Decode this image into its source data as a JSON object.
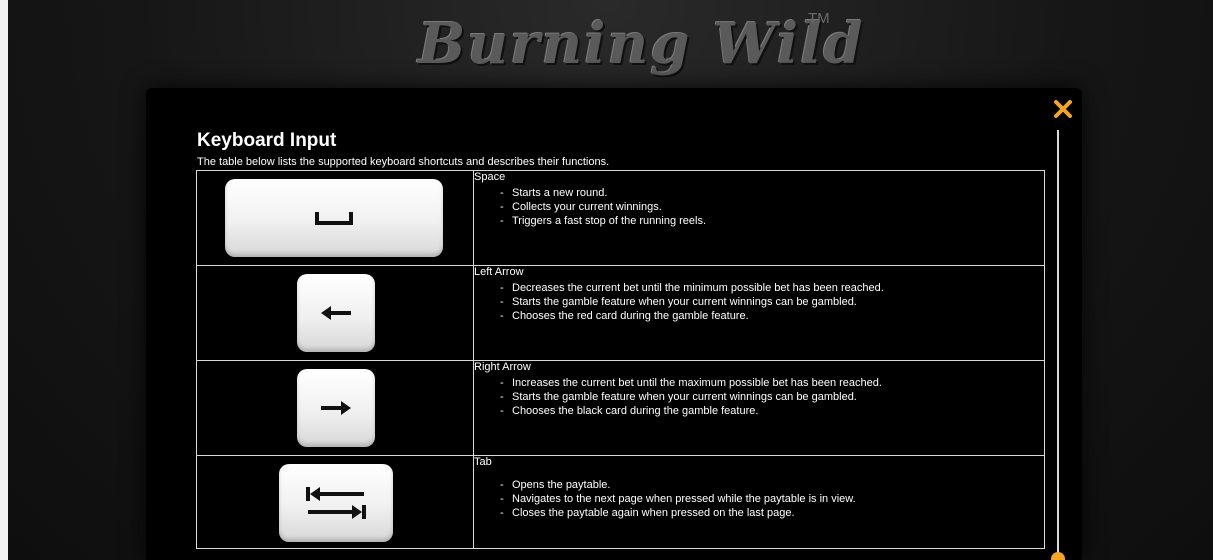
{
  "header": {
    "logo_text": "Burning Wild",
    "trademark": "TM"
  },
  "modal": {
    "title": "Keyboard Input",
    "subtitle": "The table below lists the supported keyboard shortcuts and describes their functions.",
    "close_icon": "close-icon",
    "accent_color": "#f5a623"
  },
  "shortcuts": [
    {
      "key": "Space",
      "icon": "space-key-icon",
      "functions": [
        "Starts a new round.",
        "Collects your current winnings.",
        "Triggers a fast stop of the running reels."
      ]
    },
    {
      "key": "Left Arrow",
      "icon": "left-arrow-key-icon",
      "functions": [
        "Decreases the current bet until the minimum possible bet has been reached.",
        "Starts the gamble feature when your current winnings can be gambled.",
        "Chooses the red card during the gamble feature."
      ]
    },
    {
      "key": "Right Arrow",
      "icon": "right-arrow-key-icon",
      "functions": [
        "Increases the current bet until the maximum possible bet has been reached.",
        "Starts the gamble feature when your current winnings can be gambled.",
        "Chooses the black card during the gamble feature."
      ]
    },
    {
      "key": "Tab",
      "icon": "tab-key-icon",
      "functions": [
        "Opens the paytable.",
        "Navigates to the next page when pressed while the paytable is in view.",
        "Closes the paytable again when pressed on the last page."
      ]
    }
  ]
}
